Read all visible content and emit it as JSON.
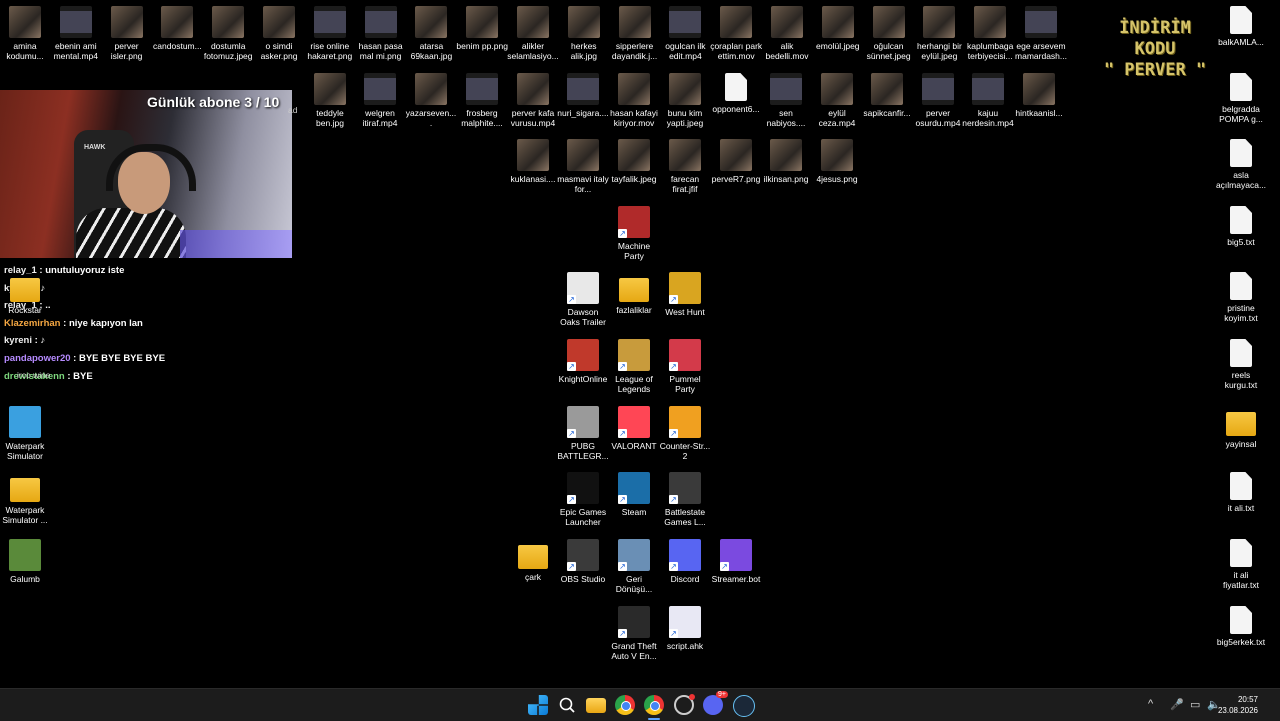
{
  "stream": {
    "sub_counter": "Günlük abone 3 / 10",
    "promo_line1": "İNDİRİM KODU",
    "promo_line2": "\" PERVER \"",
    "chair_brand": "HAWK"
  },
  "chat": [
    {
      "user": "relay_1",
      "text": ": unutuluyoruz iste",
      "color": "white"
    },
    {
      "user": "kyreni",
      "text": ": ♪",
      "color": "white"
    },
    {
      "user": "relay_1",
      "text": ": ..",
      "color": "white"
    },
    {
      "user": "Klazemirhan",
      "text": ": niye kapıyon lan",
      "color": "orange"
    },
    {
      "user": "kyreni",
      "text": ": ♪",
      "color": "white"
    },
    {
      "user": "pandapower20",
      "text": ": BYE BYE BYE BYE",
      "color": "purple"
    },
    {
      "user": "drewistakenn",
      "text": ": BYE",
      "color": "green"
    }
  ],
  "desktop_icons": {
    "top_row": [
      {
        "label": "amina kodumu...",
        "kind": "thumb"
      },
      {
        "label": "ebenin ami mental.mp4",
        "kind": "vid"
      },
      {
        "label": "perver isler.png",
        "kind": "thumb"
      },
      {
        "label": "candostum...",
        "kind": "thumb"
      },
      {
        "label": "dostumla fotomuz.jpeg",
        "kind": "thumb"
      },
      {
        "label": "o simdi asker.png",
        "kind": "thumb"
      },
      {
        "label": "rise online hakaret.png",
        "kind": "vid"
      },
      {
        "label": "hasan pasa mal mi.png",
        "kind": "vid"
      },
      {
        "label": "atarsa 69kaan.jpg",
        "kind": "thumb"
      },
      {
        "label": "benim pp.png",
        "kind": "thumb"
      },
      {
        "label": "alikler selamlasiyo...",
        "kind": "thumb"
      },
      {
        "label": "herkes alik.jpg",
        "kind": "thumb"
      },
      {
        "label": "sipperlere dayandik.j...",
        "kind": "thumb"
      },
      {
        "label": "ogulcan ilk edit.mp4",
        "kind": "vid"
      },
      {
        "label": "çorapları park ettim.mov",
        "kind": "thumb"
      },
      {
        "label": "alik bedelli.mov",
        "kind": "thumb"
      },
      {
        "label": "emolül.jpeg",
        "kind": "thumb"
      },
      {
        "label": "oğulcan sünnet.jpeg",
        "kind": "thumb"
      },
      {
        "label": "herhangi bir eylül.jpeg",
        "kind": "thumb"
      },
      {
        "label": "kaplumbaga terbiyecisi...",
        "kind": "thumb"
      },
      {
        "label": "ege arsevem mamardash...",
        "kind": "vid"
      }
    ],
    "second_row": [
      {
        "label": "teddyle ben.jpg",
        "kind": "thumb"
      },
      {
        "label": "welgren itiraf.mp4",
        "kind": "vid"
      },
      {
        "label": "yazarseven....",
        "kind": "thumb"
      },
      {
        "label": "frosberg malphite....",
        "kind": "vid"
      },
      {
        "label": "perver kafa vurusu.mp4",
        "kind": "thumb"
      },
      {
        "label": "nuri_sigara....",
        "kind": "vid"
      },
      {
        "label": "hasan kafayi kiriyor.mov",
        "kind": "thumb"
      },
      {
        "label": "bunu kim yapti.jpeg",
        "kind": "thumb"
      },
      {
        "label": "opponent6...",
        "kind": "doc"
      },
      {
        "label": "sen nabiyos....",
        "kind": "vid"
      },
      {
        "label": "eylül ceza.mp4",
        "kind": "thumb"
      },
      {
        "label": "sapikcanfir...",
        "kind": "thumb"
      },
      {
        "label": "perver osurdu.mp4",
        "kind": "vid"
      },
      {
        "label": "kajuu nerdesin.mp4",
        "kind": "vid"
      },
      {
        "label": "hintkaanisl...",
        "kind": "thumb"
      }
    ],
    "third_row": [
      {
        "label": "kuklanasi....",
        "kind": "thumb"
      },
      {
        "label": "masmavi italy for...",
        "kind": "thumb"
      },
      {
        "label": "tayfalik.jpeg",
        "kind": "thumb"
      },
      {
        "label": "farecan firat.jfif",
        "kind": "thumb"
      },
      {
        "label": "perveR7.png",
        "kind": "thumb"
      },
      {
        "label": "ilkinsan.png",
        "kind": "thumb"
      },
      {
        "label": "4jesus.png",
        "kind": "thumb"
      }
    ],
    "apps": [
      {
        "label": "Machine Party",
        "color": "#b02a2a"
      },
      {
        "label": "Dawson Oaks Trailer Park",
        "color": "#e8e8e8"
      },
      {
        "label": "fazlaliklar",
        "color": "#f2c230"
      },
      {
        "label": "West Hunt",
        "color": "#d9a520"
      },
      {
        "label": "KnightOnline",
        "color": "#c0392b"
      },
      {
        "label": "League of Legends",
        "color": "#c89b3c"
      },
      {
        "label": "Pummel Party",
        "color": "#d33a4a"
      },
      {
        "label": "PUBG BATTLEGR...",
        "color": "#9a9a9a"
      },
      {
        "label": "VALORANT",
        "color": "#ff4655"
      },
      {
        "label": "Counter-Str... 2",
        "color": "#f0a020"
      },
      {
        "label": "Epic Games Launcher",
        "color": "#111111"
      },
      {
        "label": "Steam",
        "color": "#1b6ea8"
      },
      {
        "label": "Battlestate Games L...",
        "color": "#3a3a3a"
      },
      {
        "label": "çark",
        "color": "#f2c230"
      },
      {
        "label": "OBS Studio",
        "color": "#3a3a3a"
      },
      {
        "label": "Geri Dönüşü...",
        "color": "#6a8fb5"
      },
      {
        "label": "Discord",
        "color": "#5865f2"
      },
      {
        "label": "Streamer.bot",
        "color": "#7b4ae0"
      },
      {
        "label": "Grand Theft Auto V En...",
        "color": "#2a2a2a"
      },
      {
        "label": "script.ahk",
        "color": "#e8e8f4"
      }
    ],
    "left_col": [
      {
        "label": "Rockstar",
        "color": "#f2c230"
      },
      {
        "label": "Waterpark Simulator",
        "color": "#3aa0e0"
      },
      {
        "label": "Waterpark Simulator ...",
        "color": "#f2c230"
      },
      {
        "label": "Galumb",
        "color": "#5a8a3a"
      }
    ],
    "hidden_partial": [
      {
        "label": "ad"
      },
      {
        "label": "irco wine"
      }
    ],
    "right_col": [
      {
        "label": "balkAMLA..."
      },
      {
        "label": "belgradda POMPA g..."
      },
      {
        "label": "asla açılmayaca..."
      },
      {
        "label": "big5.txt"
      },
      {
        "label": "pristine koyim.txt"
      },
      {
        "label": "reels kurgu.txt"
      },
      {
        "label": "yayinsal"
      },
      {
        "label": "it ali.txt"
      },
      {
        "label": "it ali fiyatlar.txt"
      },
      {
        "label": "big5erkek.txt"
      }
    ]
  },
  "taskbar": {
    "clock_time": "20:57",
    "clock_date": "23.08.2026",
    "tray_chevron": "^",
    "discord_badge": "9+"
  }
}
